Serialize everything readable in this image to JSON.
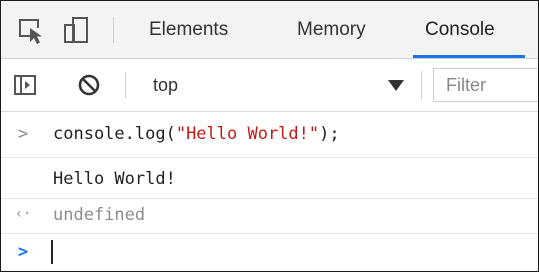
{
  "tabs": [
    {
      "label": "Elements",
      "active": false
    },
    {
      "label": "Memory",
      "active": false
    },
    {
      "label": "Console",
      "active": true
    }
  ],
  "toolbar": {
    "context": "top",
    "filter_placeholder": "Filter"
  },
  "console": {
    "input": {
      "prefix": ">",
      "code_before": "console.log(",
      "code_string": "\"Hello World!\"",
      "code_after": ");"
    },
    "output": "Hello World!",
    "result": {
      "prefix": "‹·",
      "text": "undefined"
    },
    "prompt": {
      "prefix": ">"
    }
  },
  "colors": {
    "accent": "#1a73e8",
    "string": "#c41a16",
    "muted": "#8c8c8c"
  }
}
